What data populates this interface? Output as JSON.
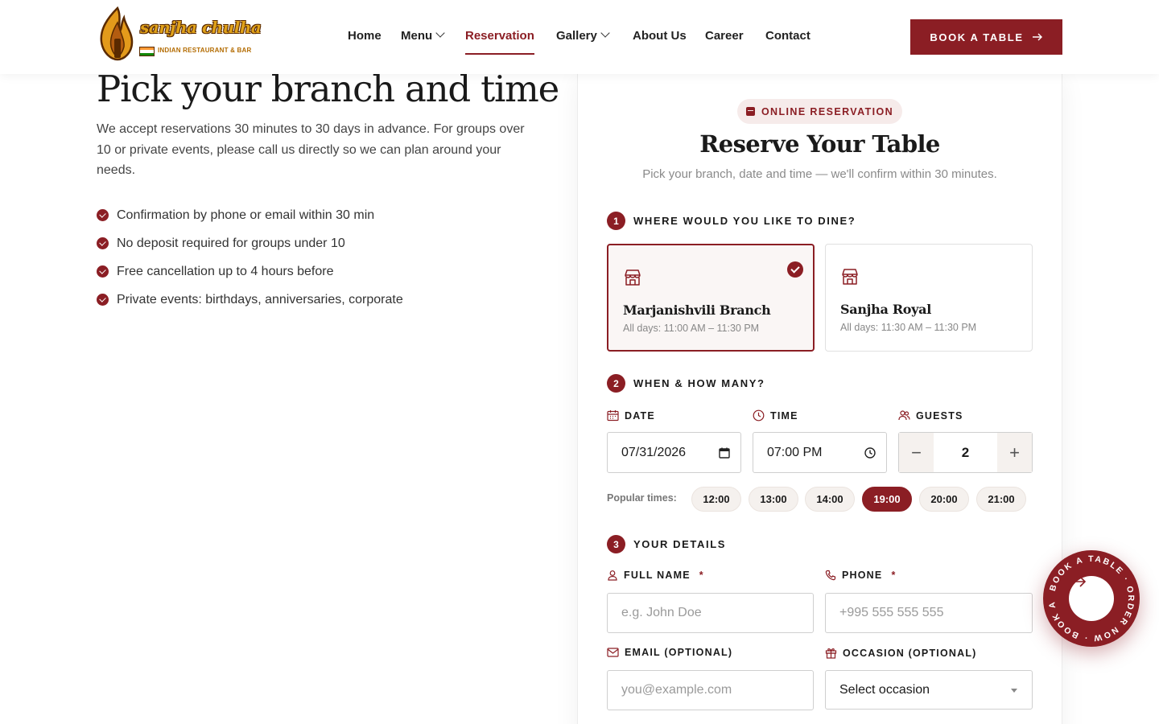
{
  "header": {
    "logo": {
      "name": "sanjha chulha",
      "tagline": "INDIAN RESTAURANT & BAR"
    },
    "nav": [
      {
        "label": "Home",
        "dropdown": false,
        "active": false
      },
      {
        "label": "Menu",
        "dropdown": true,
        "active": false
      },
      {
        "label": "Reservation",
        "dropdown": false,
        "active": true
      },
      {
        "label": "Gallery",
        "dropdown": true,
        "active": false
      },
      {
        "label": "About Us",
        "dropdown": false,
        "active": false
      },
      {
        "label": "Career",
        "dropdown": false,
        "active": false
      },
      {
        "label": "Contact",
        "dropdown": false,
        "active": false
      }
    ],
    "book_button": "BOOK A TABLE"
  },
  "intro": {
    "title": "Pick your branch and time",
    "text": "We accept reservations 30 minutes to 30 days in advance. For groups over 10 or private events, please call us directly so we can plan around your needs.",
    "features": [
      "Confirmation by phone or email within 30 min",
      "No deposit required for groups under 10",
      "Free cancellation up to 4 hours before",
      "Private events: birthdays, anniversaries, corporate"
    ]
  },
  "form": {
    "badge": "ONLINE RESERVATION",
    "title": "Reserve Your Table",
    "subtitle": "Pick your branch, date and time — we'll confirm within 30 minutes.",
    "steps": [
      {
        "num": "1",
        "label": "WHERE WOULD YOU LIKE TO DINE?"
      },
      {
        "num": "2",
        "label": "WHEN & HOW MANY?"
      },
      {
        "num": "3",
        "label": "YOUR DETAILS"
      }
    ],
    "branches": [
      {
        "name": "Marjanishvili Branch",
        "hours": "All days: 11:00 AM – 11:30 PM",
        "selected": true
      },
      {
        "name": "Sanjha Royal",
        "hours": "All days: 11:30 AM – 11:30 PM",
        "selected": false
      }
    ],
    "date": {
      "label": "DATE",
      "value": "07/31/2026"
    },
    "time": {
      "label": "TIME",
      "value": "07:00 PM"
    },
    "guests": {
      "label": "GUESTS",
      "value": "2",
      "minus": "−",
      "plus": "+"
    },
    "popular": {
      "label": "Popular times:",
      "times": [
        "12:00",
        "13:00",
        "14:00",
        "19:00",
        "20:00",
        "21:00"
      ],
      "active": "19:00"
    },
    "details": {
      "full_name": {
        "label": "FULL NAME",
        "required": "*",
        "placeholder": "e.g. John Doe"
      },
      "phone": {
        "label": "PHONE",
        "required": "*",
        "placeholder": "+995 555 555 555"
      },
      "email": {
        "label": "EMAIL (OPTIONAL)",
        "placeholder": "you@example.com"
      },
      "occasion": {
        "label": "OCCASION (OPTIONAL)",
        "value": "Select occasion"
      }
    }
  },
  "fab": {
    "ring_text": "BOOK A TABLE · ORDER NOW · BOOK A TABLE · "
  },
  "colors": {
    "accent": "#8b1e24",
    "accent_soft": "#f6ebea",
    "chip_bg": "#f5f1ee",
    "text": "#1a1a1a"
  }
}
